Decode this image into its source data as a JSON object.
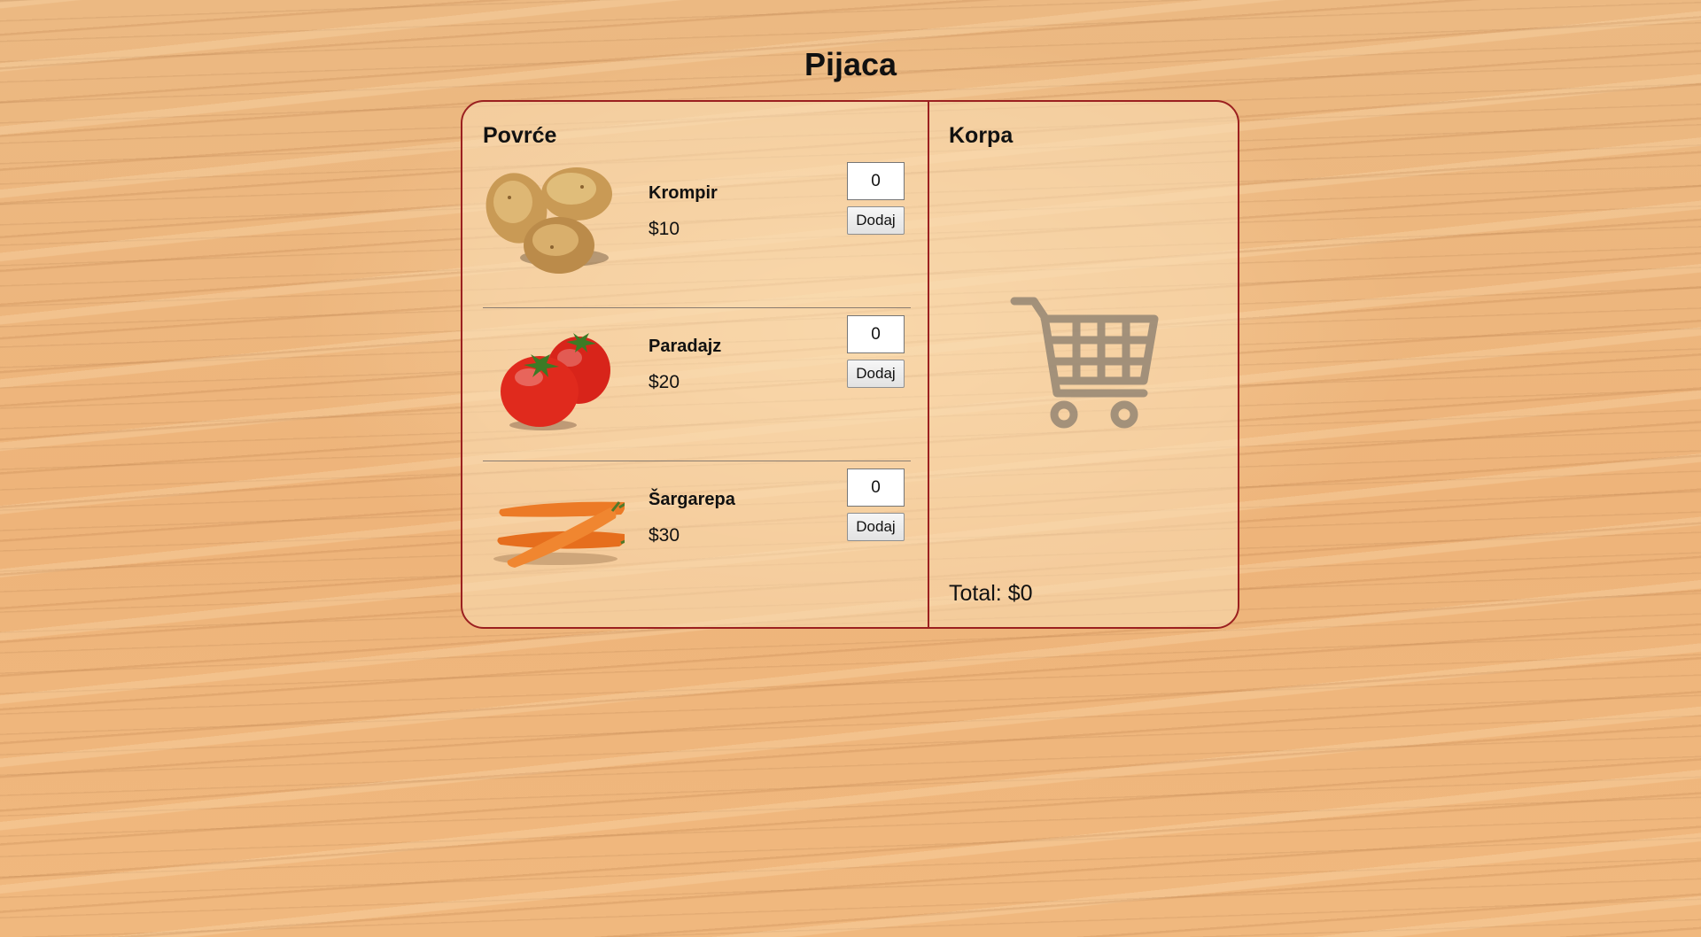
{
  "page": {
    "title": "Pijaca"
  },
  "products": {
    "section_title": "Povrće",
    "items": [
      {
        "name": "Krompir",
        "price": "$10",
        "qty": "0",
        "add_label": "Dodaj",
        "image": "potato-image"
      },
      {
        "name": "Paradajz",
        "price": "$20",
        "qty": "0",
        "add_label": "Dodaj",
        "image": "tomato-image"
      },
      {
        "name": "Šargarepa",
        "price": "$30",
        "qty": "0",
        "add_label": "Dodaj",
        "image": "carrot-image"
      }
    ]
  },
  "cart": {
    "section_title": "Korpa",
    "icon": "shopping-cart-icon",
    "total_label": "Total:",
    "total_value": "$0"
  }
}
